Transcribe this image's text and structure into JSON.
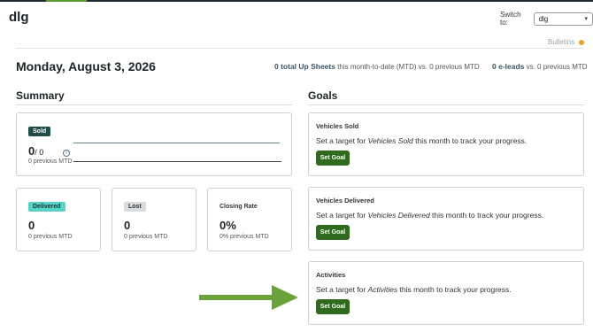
{
  "header": {
    "app_title": "dlg",
    "switch_label": "Switch to:",
    "switch_value": "dlg",
    "bulletins_label": "Bulletins"
  },
  "date_title": "Monday, August 3, 2026",
  "stats": {
    "upsheets_strong": "0 total Up Sheets",
    "upsheets_rest": " this month-to-date (MTD) vs. 0 previous MTD",
    "eleads_strong": "0 e-leads",
    "eleads_rest": " vs. 0 previous MTD"
  },
  "summary": {
    "heading": "Summary",
    "sold": {
      "badge": "Sold",
      "value": "0",
      "target": "/ 0",
      "previous": "0 previous MTD"
    },
    "delivered": {
      "badge": "Delivered",
      "value": "0",
      "previous": "0 previous MTD"
    },
    "lost": {
      "badge": "Lost",
      "value": "0",
      "previous": "0 previous MTD"
    },
    "closing_rate": {
      "label": "Closing Rate",
      "value": "0%",
      "previous": "0% previous MTD"
    }
  },
  "goals": {
    "heading": "Goals",
    "items": [
      {
        "title": "Vehicles Sold",
        "text_before": "Set a target for ",
        "text_em": "Vehicles Sold",
        "text_after": " this month to track your progress.",
        "button": "Set Goal"
      },
      {
        "title": "Vehicles Delivered",
        "text_before": "Set a target for ",
        "text_em": "Vehicles Delivered",
        "text_after": " this month to track your progress.",
        "button": "Set Goal"
      },
      {
        "title": "Activities",
        "text_before": "Set a target for ",
        "text_em": "Activities",
        "text_after": " this month to track your progress.",
        "button": "Set Goal"
      }
    ]
  },
  "colors": {
    "accent_green": "#2f6a1e",
    "arrow_green": "#6aa33a",
    "sold_badge": "#1e4d47",
    "delivered_badge": "#56d3c6",
    "bulletins_dot": "#f0a020"
  },
  "icons": [
    "info-icon",
    "chevron-down-icon",
    "notification-dot-icon",
    "pointer-arrow-icon"
  ]
}
